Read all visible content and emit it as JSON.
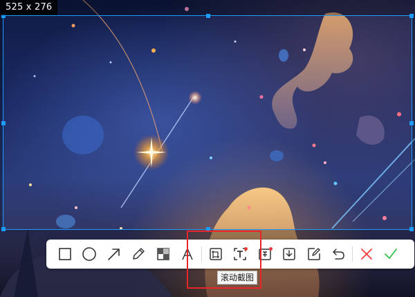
{
  "selection": {
    "size_label": "525 x 276"
  },
  "toolbar": {
    "tools": [
      {
        "name": "rectangle-tool",
        "icon": "square-outline-icon"
      },
      {
        "name": "ellipse-tool",
        "icon": "circle-outline-icon"
      },
      {
        "name": "arrow-tool",
        "icon": "arrow-up-right-icon"
      },
      {
        "name": "pencil-tool",
        "icon": "pencil-icon"
      },
      {
        "name": "mosaic-tool",
        "icon": "mosaic-icon"
      },
      {
        "name": "text-tool",
        "icon": "letter-a-icon"
      },
      {
        "name": "scroll-capture-tool",
        "icon": "scroll-capture-icon"
      },
      {
        "name": "ocr-text-tool",
        "icon": "text-recognition-icon",
        "new_badge": true
      },
      {
        "name": "pin-tool",
        "icon": "pin-icon",
        "new_badge": true
      },
      {
        "name": "save-tool",
        "icon": "download-icon"
      },
      {
        "name": "edit-tool",
        "icon": "edit-icon"
      },
      {
        "name": "undo-tool",
        "icon": "undo-icon"
      },
      {
        "name": "cancel-tool",
        "icon": "close-icon"
      },
      {
        "name": "confirm-tool",
        "icon": "check-icon"
      }
    ],
    "tooltip": "滚动截图"
  },
  "colors": {
    "selection_border": "#1e9bff",
    "cancel": "#f23a3a",
    "confirm": "#2fbf4a",
    "highlight": "#e8262a",
    "badge": "#f23a3a"
  }
}
